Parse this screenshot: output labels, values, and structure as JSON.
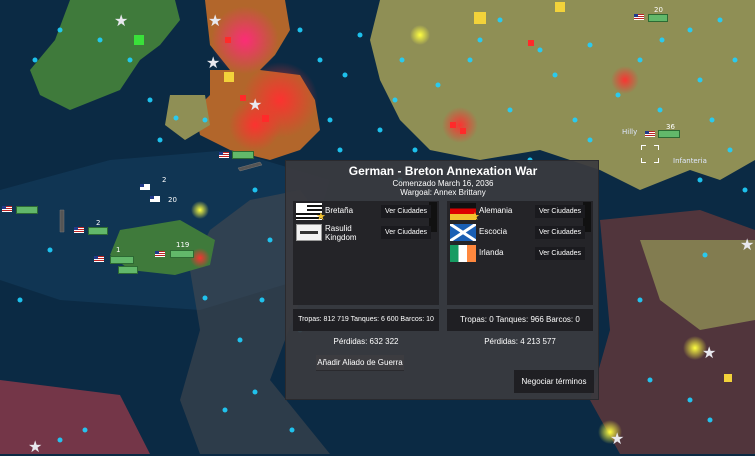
{
  "war": {
    "title": "German - Breton Annexation War",
    "started": "Comenzado March 16, 2036",
    "wargoal": "Wargoal: Annex Brittany",
    "attackers": [
      {
        "name": "Bretaña",
        "flag": "brittany-flag",
        "leader": true
      },
      {
        "name": "Rasulid Kingdom",
        "flag": "rasulid-flag",
        "leader": false
      }
    ],
    "defenders": [
      {
        "name": "Alemania",
        "flag": "germany-flag",
        "leader": true
      },
      {
        "name": "Escocia",
        "flag": "scotland-flag",
        "leader": false
      },
      {
        "name": "Irlanda",
        "flag": "ireland-flag",
        "leader": false
      }
    ],
    "view_label": "Ver Ciudades",
    "attacker_stats": "Tropas: 812 719 Tanques: 6 600 Barcos: 10",
    "defender_stats": "Tropas: 0 Tanques: 966 Barcos: 0",
    "attacker_losses": "Pérdidas: 632 322",
    "defender_losses": "Pérdidas: 4 213 577",
    "add_ally_label": "Añadir Aliado de Guerra",
    "negotiate_label": "Negociar términos"
  },
  "map": {
    "labels": {
      "hilly": "Hilly",
      "infanteria": "Infanteria",
      "unit_20": "20",
      "unit_36": "36",
      "unit_2a": "2",
      "unit_2b": "2",
      "unit_119": "119",
      "unit_1": "1",
      "unit_20b": "20"
    },
    "colors": {
      "sea": "#0b2a44",
      "land_green": "#3f7a3b",
      "land_orange": "#b2662b",
      "land_tan": "#8f8f55",
      "enemy_red": "#ff2a2a",
      "city_blue": "#1fd0ff",
      "panel_bg": "#3a3a3e"
    }
  }
}
